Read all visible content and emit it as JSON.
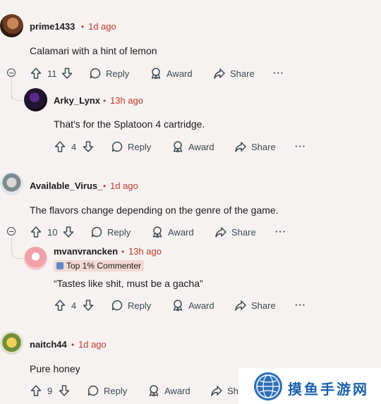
{
  "actions": {
    "reply": "Reply",
    "award": "Award",
    "share": "Share",
    "more": "···"
  },
  "comments": [
    {
      "username": "prime1433",
      "sep": "•",
      "time": "1d ago",
      "text": "Calamari with a hint of lemon",
      "votes": "11"
    },
    {
      "username": "Arky_Lynx",
      "sep": "•",
      "time": "13h ago",
      "text": "That's for the Splatoon 4 cartridge.",
      "votes": "4"
    },
    {
      "username": "Available_Virus_",
      "sep": "•",
      "time": "1d ago",
      "text": "The flavors change depending on the genre of the game.",
      "votes": "10"
    },
    {
      "username": "mvanvrancken",
      "sep": "•",
      "time": "13h ago",
      "flair": "Top 1% Commenter",
      "text": "“Tastes like shit, must be a gacha”",
      "votes": "4"
    },
    {
      "username": "naitch44",
      "sep": "•",
      "time": "1d ago",
      "text": "Pure honey",
      "votes": "9"
    }
  ],
  "watermark": {
    "text": "摸鱼手游网"
  },
  "colors": {
    "background": "#f6f2f1",
    "timestamp": "#c23a2b",
    "action": "#3c4a52",
    "flair_bg": "#f3d8d3"
  }
}
